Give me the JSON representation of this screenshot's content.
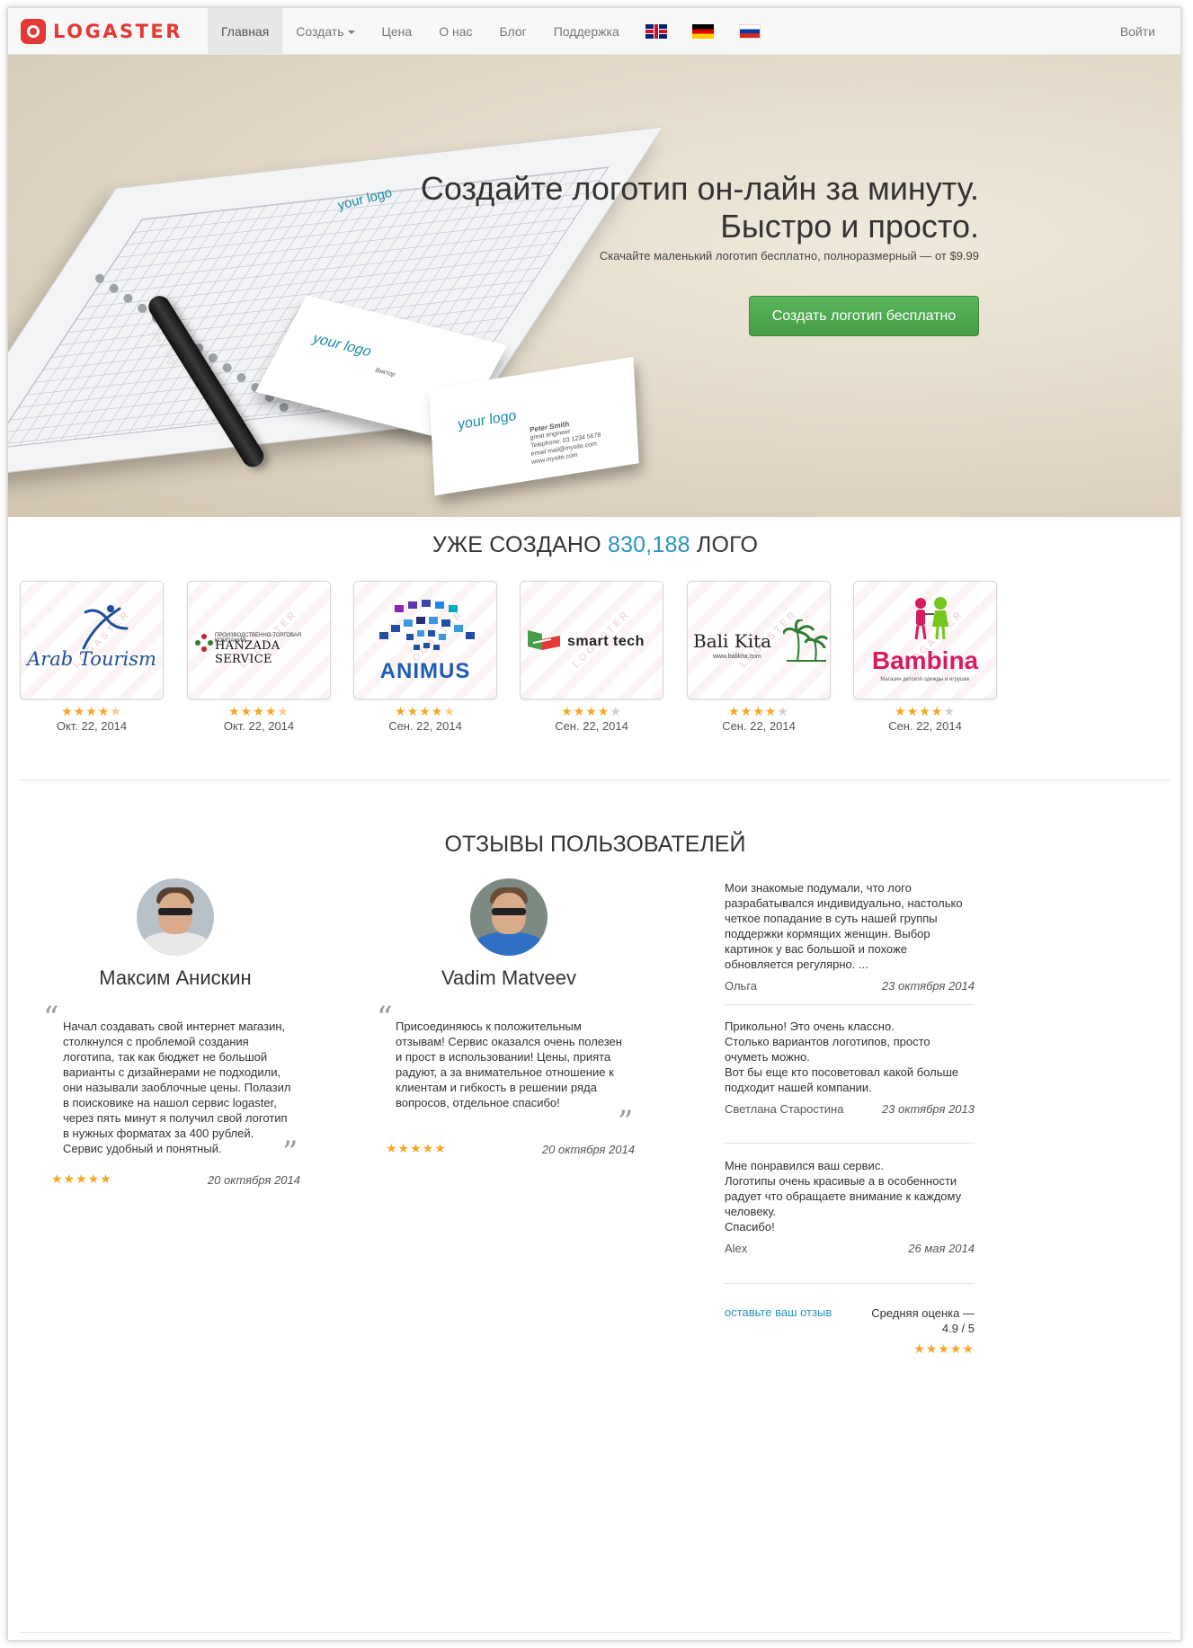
{
  "nav": {
    "brand": "LOGASTER",
    "items": [
      {
        "label": "Главная",
        "active": true
      },
      {
        "label": "Создать",
        "dropdown": true
      },
      {
        "label": "Цена"
      },
      {
        "label": "О нас"
      },
      {
        "label": "Блог"
      },
      {
        "label": "Поддержка"
      }
    ],
    "flags": [
      "uk-flag-icon",
      "germany-flag-icon",
      "russia-flag-icon"
    ],
    "login": "Войти"
  },
  "hero": {
    "title_line1": "Создайте логотип он-лайн за минуту.",
    "title_line2": "Быстро и просто.",
    "subtitle": "Скачайте маленький логотип бесплатно, полноразмерный — от $9.99",
    "cta": "Создать логотип бесплатно",
    "mock_logo_text": "your logo",
    "card_person": "Peter Smith",
    "card_role": "great engineer",
    "card_phone": "Telephone: 03 1234 5678",
    "card_email": "email mail@mysite.com",
    "card_site": "www.mysite.com",
    "card_name_ru": "Виктор"
  },
  "counter": {
    "prefix": "УЖЕ СОЗДАНО",
    "number": "830,188",
    "suffix": "ЛОГО"
  },
  "logos": [
    {
      "name": "Arab Tourism",
      "rating": 4.5,
      "date": "Окт. 22, 2014"
    },
    {
      "name": "HANZADA SERVICE",
      "tagline": "ПРОИЗВОДСТВЕННО-ТОРГОВАЯ КОМПАНИЯ",
      "rating": 4.5,
      "date": "Окт. 22, 2014"
    },
    {
      "name": "ANIMUS",
      "rating": 4.5,
      "date": "Сен. 22, 2014"
    },
    {
      "name": "smart tech",
      "rating": 4,
      "date": "Сен. 22, 2014"
    },
    {
      "name": "Bali Kita",
      "tagline": "www.balikita.com",
      "rating": 4,
      "date": "Сен. 22, 2014"
    },
    {
      "name": "Bambina",
      "tagline": "Магазин детской одежды и игрушек",
      "rating": 4,
      "date": "Сен. 22, 2014"
    }
  ],
  "watermark": "LOGASTER",
  "reviews": {
    "title": "ОТЗЫВЫ ПОЛЬЗОВАТЕЛЕЙ",
    "featured": [
      {
        "name": "Максим Анискин",
        "text": "Начал создавать свой интернет магазин, столкнулся с проблемой создания логотипа, так как бюджет не большой варианты с дизайнерами не подходили, они называли заоблочные цены. Полазил в поисковике на нашол сервис logaster, через пять минут я получил свой логотип в нужных форматах за 400 рублей. Сервис удобный и понятный.",
        "rating": 5,
        "date": "20 октября 2014"
      },
      {
        "name": "Vadim Matveev",
        "text": "Присоединяюсь к положительным отзывам! Сервис оказался очень полезен и прост в использовании! Цены, прията радуют, а за внимательное отношение к клиентам и гибкость в решении ряда вопросов, отдельное спасибо!",
        "rating": 5,
        "date": "20 октября 2014"
      }
    ],
    "side": [
      {
        "text": "Мои знакомые подумали, что лого разрабатывался индивидуально, настолько четкое попадание в суть нашей группы поддержки кормящих женщин. Выбор картинок у вас большой и похоже обновляется регулярно. ...",
        "author": "Ольга",
        "date": "23 октября 2014"
      },
      {
        "text": "Прикольно! Это очень классно.\nСтолько вариантов логотипов, просто очуметь можно.\nВот бы еще кто посоветовал какой больше подходит нашей компании.",
        "author": "Светлана Старостина",
        "date": "23 октября 2013"
      },
      {
        "text": "Мне понравился ваш сервис.\nЛоготипы очень красивые а в особенности радует что обращаете внимание к каждому человеку.\nСпасибо!",
        "author": "Alex",
        "date": "26 мая 2014"
      }
    ],
    "leave_link": "оставьте ваш отзыв",
    "average_label": "Средняя оценка —",
    "average_value": "4.9 / 5",
    "average_rating": 4.9
  },
  "colors": {
    "brand_red": "#e53935",
    "accent_blue": "#2a93c1",
    "cta_green": "#5cb85c",
    "star": "#f5a623"
  }
}
